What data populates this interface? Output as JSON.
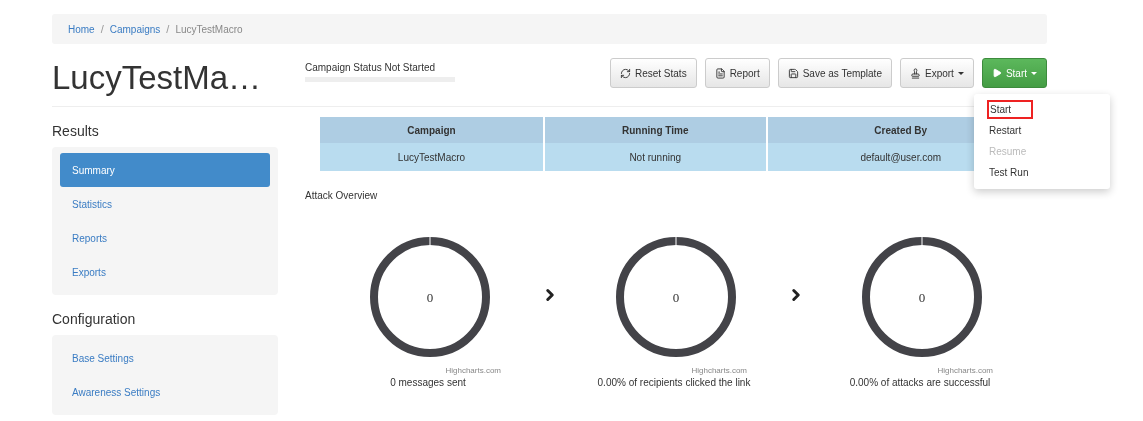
{
  "breadcrumb": [
    {
      "label": "Home",
      "kind": "link"
    },
    {
      "label": "/",
      "kind": "separator"
    },
    {
      "label": "Campaigns",
      "kind": "link"
    },
    {
      "label": "/",
      "kind": "separator"
    },
    {
      "label": "LucyTestMacro",
      "kind": "current"
    }
  ],
  "page_title": "LucyTestMa…",
  "campaign_status": {
    "label": "Campaign Status Not Started",
    "level": 0
  },
  "toolbar": [
    {
      "label": "Reset Stats",
      "kind": "reset",
      "dropdown": false,
      "primary": false
    },
    {
      "label": "Report",
      "kind": "report",
      "dropdown": false,
      "primary": false
    },
    {
      "label": "Save as Template",
      "kind": "template",
      "dropdown": false,
      "primary": false
    },
    {
      "label": "Export",
      "kind": "export",
      "dropdown": true,
      "primary": false
    },
    {
      "label": "Start",
      "kind": "start",
      "dropdown": true,
      "primary": true
    }
  ],
  "start_menu": [
    {
      "label": "Start",
      "disabled": false,
      "selected": true
    },
    {
      "label": "Restart",
      "disabled": false,
      "selected": false
    },
    {
      "label": "Resume",
      "disabled": true,
      "selected": false
    },
    {
      "label": "Test Run",
      "disabled": false,
      "selected": false
    }
  ],
  "sections": [
    {
      "title": "Results",
      "items": [
        {
          "label": "Summary",
          "selected": true
        },
        {
          "label": "Statistics",
          "selected": false
        },
        {
          "label": "Reports",
          "selected": false
        },
        {
          "label": "Exports",
          "selected": false
        }
      ]
    },
    {
      "title": "Configuration",
      "items": [
        {
          "label": "Base Settings",
          "selected": false
        },
        {
          "label": "Awareness Settings",
          "selected": false
        }
      ]
    }
  ],
  "table": {
    "columns": [
      "Campaign",
      "Running Time",
      "Created By"
    ],
    "rows": [
      [
        "LucyTestMacro",
        "Not running",
        "default@user.com"
      ]
    ]
  },
  "overview": {
    "title": "Attack Overview",
    "gauges": [
      {
        "value": "0",
        "credit": "Highcharts.com",
        "caption": "0 messages sent"
      },
      {
        "value": "0",
        "credit": "Highcharts.com",
        "caption": "0.00% of recipients clicked the link"
      },
      {
        "value": "0",
        "credit": "Highcharts.com",
        "caption": "0.00% of attacks are successful"
      }
    ]
  }
}
